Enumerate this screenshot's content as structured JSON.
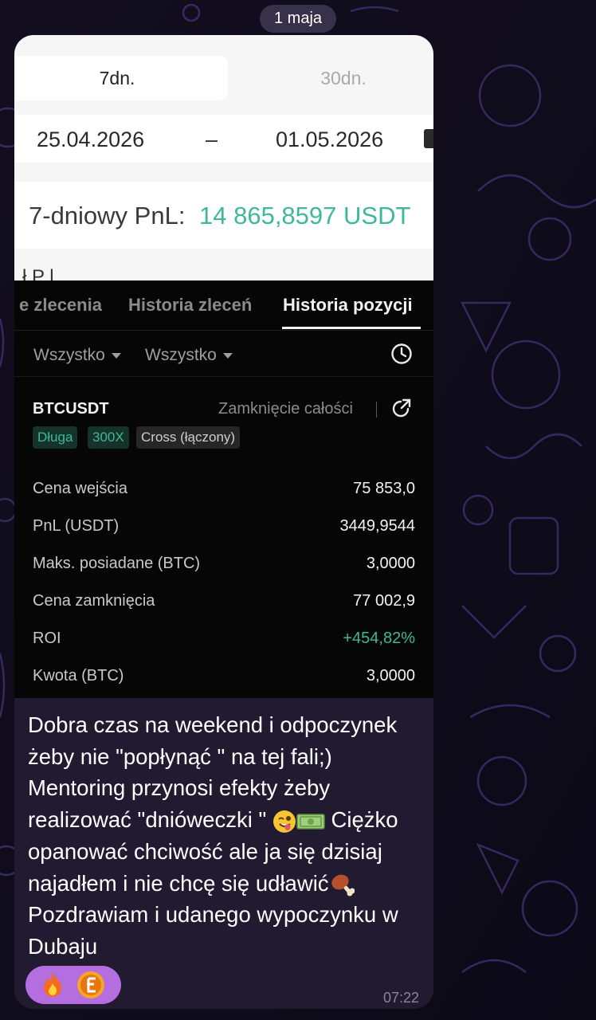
{
  "date_pill": "1 maja",
  "screenshot_top": {
    "period_tabs": [
      "7dn.",
      "30dn."
    ],
    "date_range": {
      "start": "25.04.2026",
      "separator": "–",
      "end": "01.05.2026"
    },
    "pnl_label": "7-dniowy PnL:",
    "pnl_value": "14 865,8597 USDT",
    "cut_text": "ł     P l"
  },
  "screenshot_bottom": {
    "tabs": [
      "e zlecenia",
      "Historia zleceń",
      "Historia pozycji"
    ],
    "filters": [
      "Wszystko",
      "Wszystko"
    ],
    "position": {
      "symbol": "BTCUSDT",
      "close_label": "Zamknięcie całości",
      "badges": [
        "Długa",
        "300X",
        "Cross (łączony)"
      ],
      "rows": [
        {
          "label": "Cena wejścia",
          "value": "75 853,0"
        },
        {
          "label": "PnL (USDT)",
          "value": "3449,9544"
        },
        {
          "label": "Maks. posiadane (BTC)",
          "value": "3,0000"
        },
        {
          "label": "Cena zamknięcia",
          "value": "77 002,9"
        },
        {
          "label": "ROI",
          "value": "+454,82%"
        },
        {
          "label": "Kwota (BTC)",
          "value": "3,0000"
        }
      ]
    }
  },
  "message": {
    "text_part1": "Dobra czas na weekend i odpoczynek żeby nie \"popłynąć \" na tej fali;) Mentoring przynosi efekty żeby realizować \"dnióweczki \" ",
    "text_part2": " Ciężko opanować chciwość ale ja się dzisiaj najadłem i nie chcę się udławić",
    "text_part3": " Pozdrawiam i udanego wypoczynku w Dubaju",
    "emoji_icons": [
      "winking-face-tongue-icon",
      "dollar-banknote-icon",
      "meat-on-bone-icon"
    ],
    "time": "07:22"
  },
  "reactions": [
    "fire-icon",
    "coin-avatar-icon"
  ],
  "colors": {
    "accent_green": "#3fb89a",
    "bubble": "#211a30",
    "reaction": "#b56ee0"
  }
}
